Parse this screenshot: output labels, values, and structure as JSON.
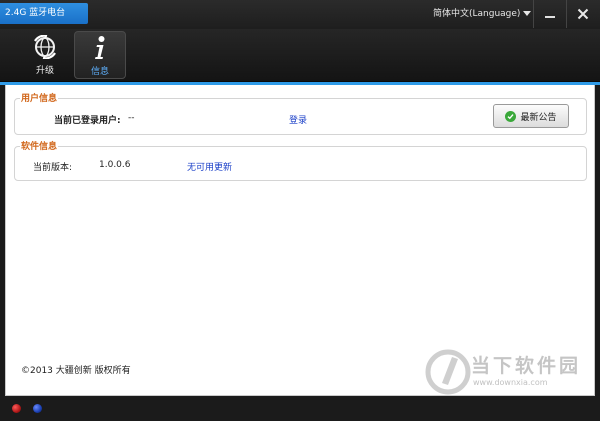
{
  "window": {
    "title": "2.4G 蓝牙电台",
    "language": "简体中文(Language)",
    "minimize_icon": "minimize-icon",
    "close_icon": "close-icon"
  },
  "toolbar": {
    "items": [
      {
        "label": "升级",
        "icon": "upgrade-globe-icon",
        "active": false
      },
      {
        "label": "信息",
        "icon": "info-icon",
        "active": true
      }
    ]
  },
  "user_info": {
    "title": "用户信息",
    "current_user_label": "当前已登录用户:",
    "current_user_value": "--",
    "login_link": "登录",
    "notice_button": "最新公告",
    "notice_icon": "check-circle-icon"
  },
  "software_info": {
    "title": "软件信息",
    "version_label": "当前版本:",
    "version_value": "1.0.0.6",
    "update_link": "无可用更新"
  },
  "footer": {
    "copyright": "©2013 大疆创新 版权所有"
  },
  "watermark": {
    "text": "当下软件园",
    "url": "www.downxia.com"
  },
  "status": {
    "leds": [
      {
        "name": "red-led",
        "color": "#b01818"
      },
      {
        "name": "blue-led",
        "color": "#1a3fb0"
      }
    ]
  },
  "colors": {
    "accent": "#2f9be8",
    "group_title": "#d2691e",
    "link": "#1a3fc8"
  }
}
